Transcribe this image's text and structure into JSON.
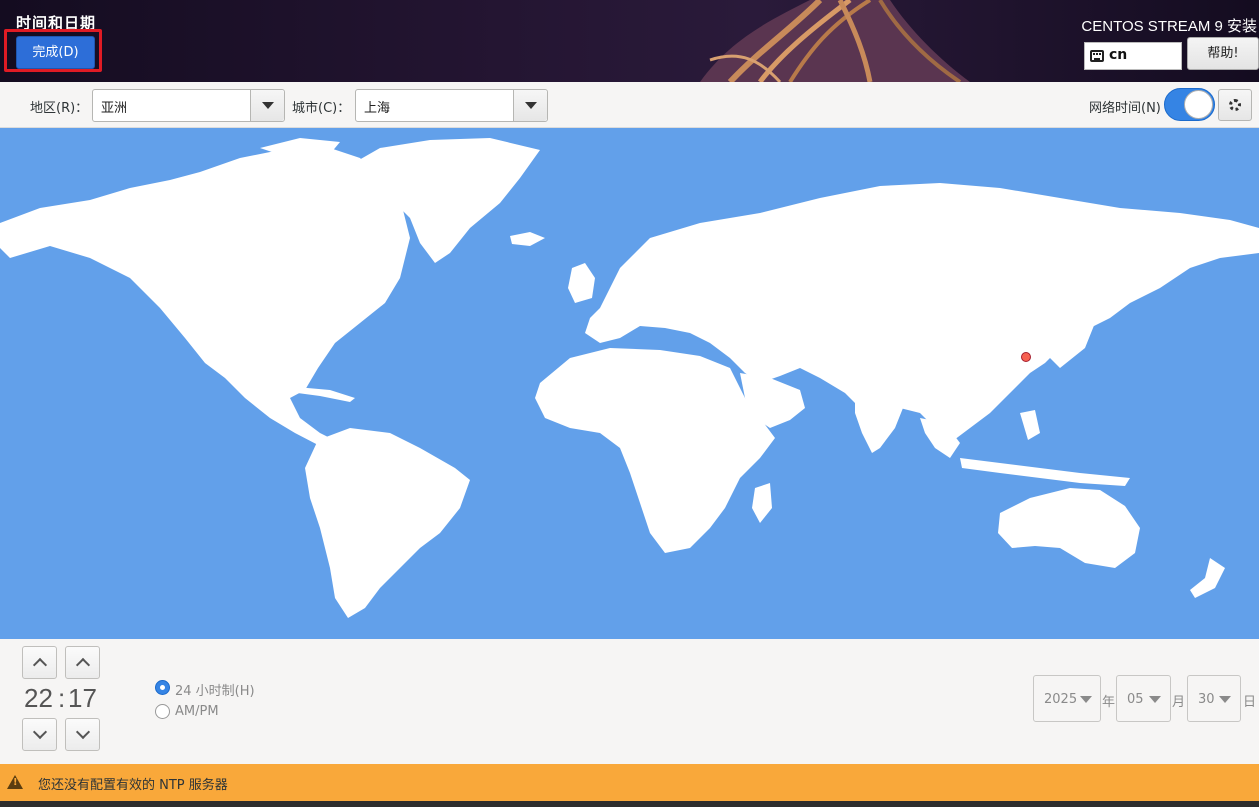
{
  "header": {
    "page_title": "时间和日期",
    "done_label": "完成(D)",
    "product_title": "CENTOS STREAM 9 安装",
    "keyboard_layout": "cn",
    "help_label": "帮助!"
  },
  "toolbar": {
    "region_label": "地区(R)：",
    "region_value": "亚洲",
    "city_label": "城市(C)：",
    "city_value": "上海",
    "network_time_label": "网络时间(N)",
    "network_time_enabled": true
  },
  "map": {
    "selected_city_marker_color": "#f66151",
    "ocean_color": "#62a0ea",
    "land_color": "#ffffff"
  },
  "time": {
    "hours": "22",
    "colon": ":",
    "minutes": "17",
    "format_24h_label": "24 小时制(H)",
    "format_ampm_label": "AM/PM",
    "selected_format": "24h"
  },
  "date": {
    "year": "2025",
    "year_unit": "年",
    "month": "05",
    "month_unit": "月",
    "day": "30",
    "day_unit": "日"
  },
  "warning": {
    "text": "您还没有配置有效的 NTP 服务器",
    "color": "#f9a83a"
  },
  "colors": {
    "accent": "#3584e4",
    "done_button": "#2d6ed8",
    "highlight": "#e01b24"
  }
}
